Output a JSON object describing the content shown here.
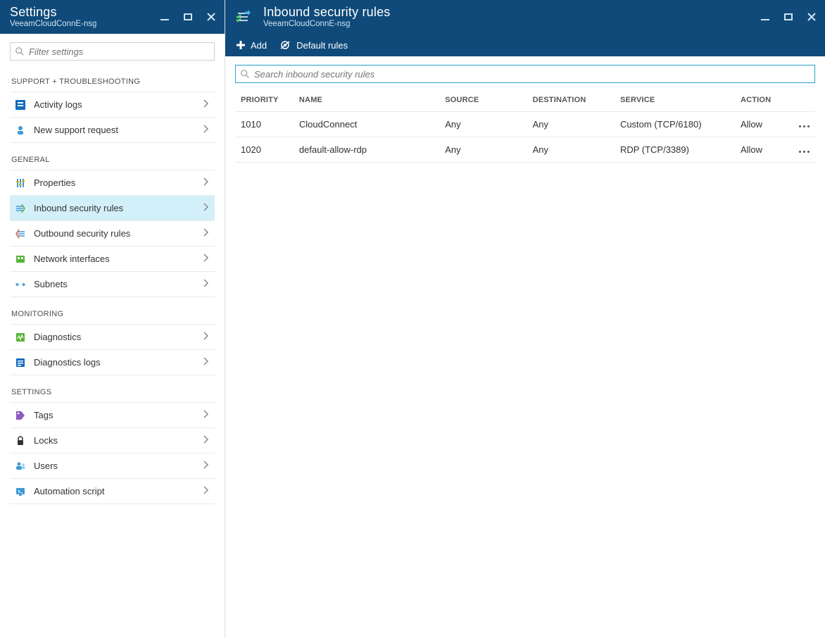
{
  "settings_panel": {
    "title": "Settings",
    "subtitle": "VeeamCloudConnE-nsg",
    "filter_placeholder": "Filter settings",
    "sections": [
      {
        "title": "SUPPORT + TROUBLESHOOTING",
        "items": [
          {
            "label": "Activity logs"
          },
          {
            "label": "New support request"
          }
        ]
      },
      {
        "title": "GENERAL",
        "items": [
          {
            "label": "Properties"
          },
          {
            "label": "Inbound security rules"
          },
          {
            "label": "Outbound security rules"
          },
          {
            "label": "Network interfaces"
          },
          {
            "label": "Subnets"
          }
        ]
      },
      {
        "title": "MONITORING",
        "items": [
          {
            "label": "Diagnostics"
          },
          {
            "label": "Diagnostics logs"
          }
        ]
      },
      {
        "title": "SETTINGS",
        "items": [
          {
            "label": "Tags"
          },
          {
            "label": "Locks"
          },
          {
            "label": "Users"
          },
          {
            "label": "Automation script"
          }
        ]
      }
    ]
  },
  "main_panel": {
    "title": "Inbound security rules",
    "subtitle": "VeeamCloudConnE-nsg",
    "commands": {
      "add": "Add",
      "default_rules": "Default rules"
    },
    "search_placeholder": "Search inbound security rules",
    "columns": {
      "priority": "PRIORITY",
      "name": "NAME",
      "source": "SOURCE",
      "destination": "DESTINATION",
      "service": "SERVICE",
      "action": "ACTION"
    },
    "rows": [
      {
        "priority": "1010",
        "name": "CloudConnect",
        "source": "Any",
        "destination": "Any",
        "service": "Custom (TCP/6180)",
        "action": "Allow"
      },
      {
        "priority": "1020",
        "name": "default-allow-rdp",
        "source": "Any",
        "destination": "Any",
        "service": "RDP (TCP/3389)",
        "action": "Allow"
      }
    ]
  }
}
